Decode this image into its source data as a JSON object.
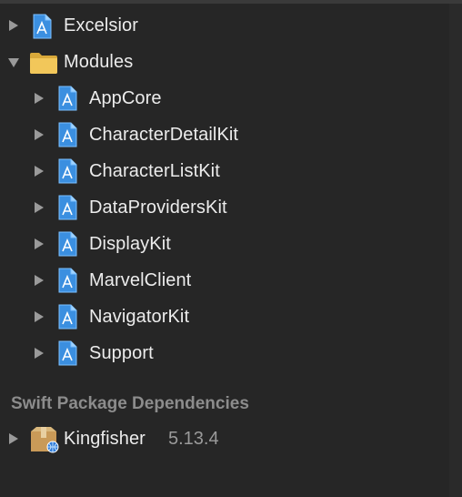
{
  "navigator": {
    "items": [
      {
        "label": "Excelsior",
        "icon": "swift-package-icon",
        "expanded": false
      },
      {
        "label": "Modules",
        "icon": "folder-icon",
        "expanded": true
      },
      {
        "label": "AppCore",
        "icon": "swift-package-icon",
        "expanded": false
      },
      {
        "label": "CharacterDetailKit",
        "icon": "swift-package-icon",
        "expanded": false
      },
      {
        "label": "CharacterListKit",
        "icon": "swift-package-icon",
        "expanded": false
      },
      {
        "label": "DataProvidersKit",
        "icon": "swift-package-icon",
        "expanded": false
      },
      {
        "label": "DisplayKit",
        "icon": "swift-package-icon",
        "expanded": false
      },
      {
        "label": "MarvelClient",
        "icon": "swift-package-icon",
        "expanded": false
      },
      {
        "label": "NavigatorKit",
        "icon": "swift-package-icon",
        "expanded": false
      },
      {
        "label": "Support",
        "icon": "swift-package-icon",
        "expanded": false
      }
    ]
  },
  "dependencies": {
    "header": "Swift Package Dependencies",
    "items": [
      {
        "label": "Kingfisher",
        "version": "5.13.4",
        "icon": "package-box-icon",
        "expanded": false
      }
    ]
  },
  "colors": {
    "background": "#262626",
    "text": "#ececec",
    "secondary_text": "#9a9a9a",
    "header_text": "#8c8c8c",
    "folder": "#e9b84a",
    "file_icon": "#4a9ee6"
  }
}
